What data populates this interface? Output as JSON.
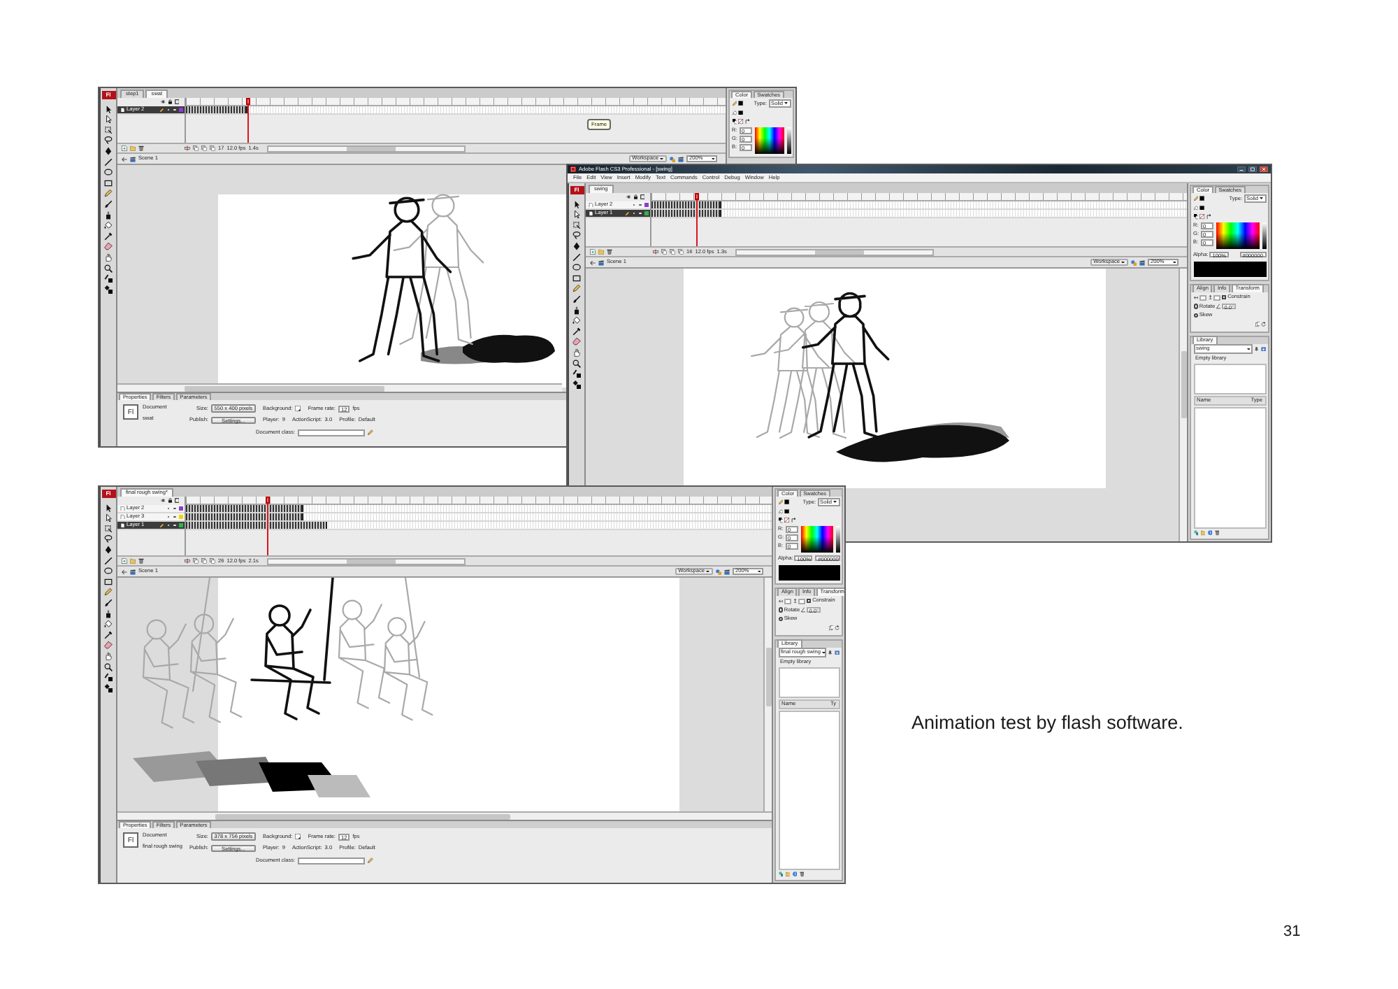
{
  "screenshots": [
    {
      "logo": "Fl",
      "tabs": [
        {
          "label": "step1",
          "selected": false
        },
        {
          "label": "swat",
          "selected": true
        }
      ],
      "layers": [
        {
          "name": "Layer 2",
          "selected": true,
          "color": "#8a3fd0",
          "level": 0.115
        }
      ],
      "playhead": {
        "level": 0.115
      },
      "tooltip": "Frame",
      "current_frame": "17",
      "frame_rate": "12.0 fps",
      "elapsed_time": "1.4s",
      "scene": "Scene 1",
      "workspace": "Workspace",
      "zoom": "200%",
      "properties": {
        "tabs": [
          {
            "label": "Properties",
            "selected": true
          },
          {
            "label": "Filters",
            "selected": false
          },
          {
            "label": "Parameters",
            "selected": false
          }
        ],
        "logo": "Fl",
        "type": "Document",
        "name": "swat",
        "size_label": "Size:",
        "size": "550 x 400 pixels",
        "background_label": "Background:",
        "frame_rate_label": "Frame rate:",
        "frame_rate": "12",
        "fps": "fps",
        "publish_label": "Publish:",
        "settings": "Settings...",
        "player_label": "Player:",
        "player": "9",
        "actionscript_label": "ActionScript:",
        "actionscript": "3.0",
        "profile_label": "Profile:",
        "profile": "Default",
        "class_label": "Document class:"
      },
      "panels": [
        {
          "kind": "color",
          "tabs": [
            {
              "label": "Color",
              "selected": true
            },
            {
              "label": "Swatches",
              "selected": false
            }
          ],
          "type_label": "Type:",
          "type": "Solid",
          "channels": [
            {
              "label": "R:",
              "value": "0"
            },
            {
              "label": "G:",
              "value": "0"
            },
            {
              "label": "B:",
              "value": "0"
            }
          ]
        }
      ]
    },
    {
      "title": "Adobe Flash CS3 Professional - [swing]",
      "menu": [
        "File",
        "Edit",
        "View",
        "Insert",
        "Modify",
        "Text",
        "Commands",
        "Control",
        "Debug",
        "Window",
        "Help"
      ],
      "logo": "Fl",
      "tabs": [
        {
          "label": "swing",
          "selected": true
        }
      ],
      "layers": [
        {
          "name": "Layer 2",
          "selected": false,
          "color": "#8a3fd0",
          "level": 0.13
        },
        {
          "name": "Layer 1",
          "selected": true,
          "color": "#2fb24a",
          "level": 0.13
        }
      ],
      "playhead": {
        "level": 0.086
      },
      "current_frame": "16",
      "frame_rate": "12.0 fps",
      "elapsed_time": "1.3s",
      "scene": "Scene 1",
      "workspace": "Workspace",
      "zoom": "200%",
      "panels": [
        {
          "kind": "color",
          "tabs": [
            {
              "label": "Color",
              "selected": true
            },
            {
              "label": "Swatches",
              "selected": false
            }
          ],
          "type_label": "Type:",
          "type": "Solid",
          "channels": [
            {
              "label": "R:",
              "value": "0"
            },
            {
              "label": "G:",
              "value": "0"
            },
            {
              "label": "B:",
              "value": "0"
            }
          ],
          "alpha_label": "Alpha:",
          "alpha": "100%",
          "hex": "#000000"
        },
        {
          "kind": "transform",
          "tabs": [
            {
              "label": "Align",
              "selected": false
            },
            {
              "label": "Info",
              "selected": false
            },
            {
              "label": "Transform",
              "selected": true
            }
          ],
          "constrain": {
            "label": "Constrain",
            "checked": false
          },
          "options": [
            {
              "label": "Rotate",
              "selected": true,
              "value": "0.0°"
            },
            {
              "label": "Skew",
              "selected": false
            }
          ]
        },
        {
          "kind": "library",
          "tabs": [
            {
              "label": "Library",
              "selected": true
            }
          ],
          "document": "swing",
          "empty": "Empty library",
          "columns": [
            "Name",
            "Type"
          ]
        }
      ]
    },
    {
      "logo": "Fl",
      "tabs": [
        {
          "label": "final rough swing*",
          "selected": true
        }
      ],
      "layers": [
        {
          "name": "Layer 2",
          "selected": false,
          "color": "#8a3fd0",
          "level": 0.2
        },
        {
          "name": "Layer 3",
          "selected": false,
          "color": "#e8d800",
          "level": 0.2
        },
        {
          "name": "Layer 1",
          "selected": true,
          "color": "#2fb24a",
          "level": 0.24
        }
      ],
      "playhead": {
        "level": 0.14
      },
      "current_frame": "26",
      "frame_rate": "12.0 fps",
      "elapsed_time": "2.1s",
      "scene": "Scene 1",
      "workspace": "Workspace",
      "zoom": "200%",
      "properties": {
        "tabs": [
          {
            "label": "Properties",
            "selected": true
          },
          {
            "label": "Filters",
            "selected": false
          },
          {
            "label": "Parameters",
            "selected": false
          }
        ],
        "logo": "Fl",
        "type": "Document",
        "name": "final rough swing",
        "size_label": "Size:",
        "size": "378 x 756 pixels",
        "background_label": "Background:",
        "frame_rate_label": "Frame rate:",
        "frame_rate": "12",
        "fps": "fps",
        "publish_label": "Publish:",
        "settings": "Settings...",
        "player_label": "Player:",
        "player": "9",
        "actionscript_label": "ActionScript:",
        "actionscript": "3.0",
        "profile_label": "Profile:",
        "profile": "Default",
        "class_label": "Document class:"
      },
      "panels": [
        {
          "kind": "color",
          "tabs": [
            {
              "label": "Color",
              "selected": true
            },
            {
              "label": "Swatches",
              "selected": false
            }
          ],
          "type_label": "Type:",
          "type": "Solid",
          "channels": [
            {
              "label": "R:",
              "value": "0"
            },
            {
              "label": "G:",
              "value": "0"
            },
            {
              "label": "B:",
              "value": "0"
            }
          ],
          "alpha_label": "Alpha:",
          "alpha": "100%",
          "hex": "#000000"
        },
        {
          "kind": "transform",
          "tabs": [
            {
              "label": "Align",
              "selected": false
            },
            {
              "label": "Info",
              "selected": false
            },
            {
              "label": "Transform",
              "selected": true
            }
          ],
          "constrain": {
            "label": "Constrain",
            "checked": false
          },
          "options": [
            {
              "label": "Rotate",
              "selected": true,
              "value": "0.0°"
            },
            {
              "label": "Skew",
              "selected": false
            }
          ]
        },
        {
          "kind": "library",
          "tabs": [
            {
              "label": "Library",
              "selected": true
            }
          ],
          "document": "final rough swing",
          "empty": "Empty library",
          "columns": [
            "Name",
            "Ty"
          ]
        }
      ]
    }
  ],
  "caption": "Animation test by flash software.",
  "page_number": "31"
}
